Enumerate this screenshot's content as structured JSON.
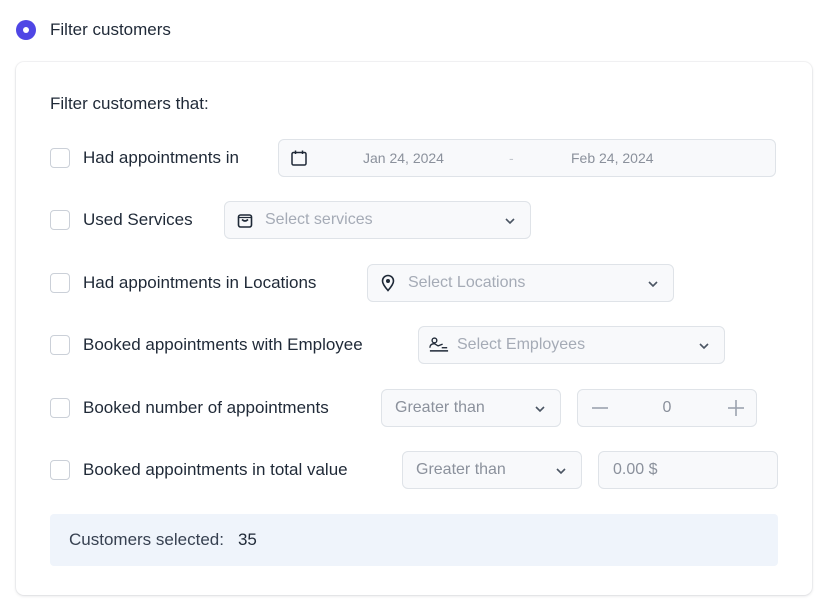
{
  "filter_toggle": {
    "label": "Filter customers"
  },
  "heading": "Filter customers that:",
  "filters": {
    "appointments_in": {
      "label": "Had appointments in",
      "start_date": "Jan 24, 2024",
      "separator": "-",
      "end_date": "Feb 24, 2024",
      "icon": "calendar-icon"
    },
    "used_services": {
      "label": "Used Services",
      "placeholder": "Select services",
      "icon": "bag-icon"
    },
    "locations": {
      "label": "Had appointments in Locations",
      "placeholder": "Select Locations",
      "icon": "location-pin-icon"
    },
    "employee": {
      "label": "Booked appointments with Employee",
      "placeholder": "Select Employees",
      "icon": "employee-icon"
    },
    "number_of_appointments": {
      "label": "Booked number of appointments",
      "comparator": "Greater than",
      "value": "0"
    },
    "total_value": {
      "label": "Booked appointments in total value",
      "comparator": "Greater than",
      "value": "0.00 $"
    }
  },
  "summary": {
    "label": "Customers selected:",
    "count": "35"
  },
  "colors": {
    "accent": "#4f46e5",
    "summary_bg": "#eff4fb",
    "field_bg": "#f8f9fb",
    "border": "#dfe3e8"
  }
}
